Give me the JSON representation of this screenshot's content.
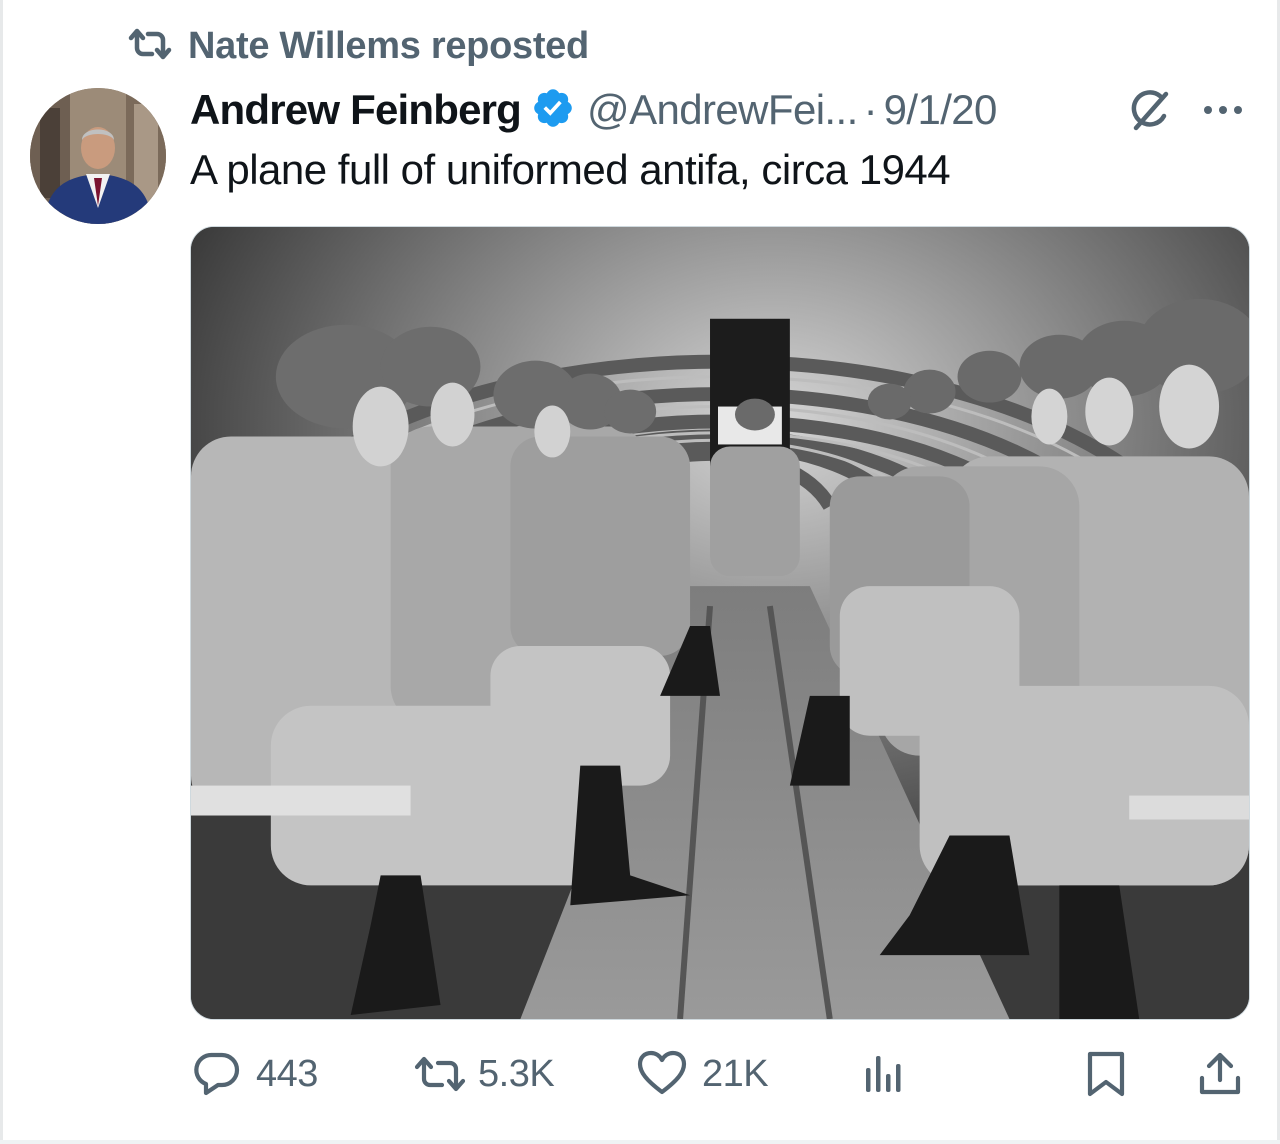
{
  "repost": {
    "label": "Nate Willems reposted"
  },
  "tweet": {
    "display_name": "Andrew Feinberg",
    "handle": "@AndrewFei...",
    "separator": "·",
    "date": "9/1/20",
    "text": "A plane full of uniformed antifa, circa 1944"
  },
  "actions": {
    "replies": "443",
    "reposts": "5.3K",
    "likes": "21K"
  },
  "icons": {
    "repost": "repost-icon",
    "verified": "verified-badge-icon",
    "grok": "grok-icon",
    "more": "more-icon",
    "reply": "reply-icon",
    "like": "heart-icon",
    "views": "analytics-icon",
    "bookmark": "bookmark-icon",
    "share": "share-icon"
  },
  "colors": {
    "text_primary": "#0f1419",
    "text_secondary": "#536471",
    "verified_blue": "#1d9bf0"
  }
}
